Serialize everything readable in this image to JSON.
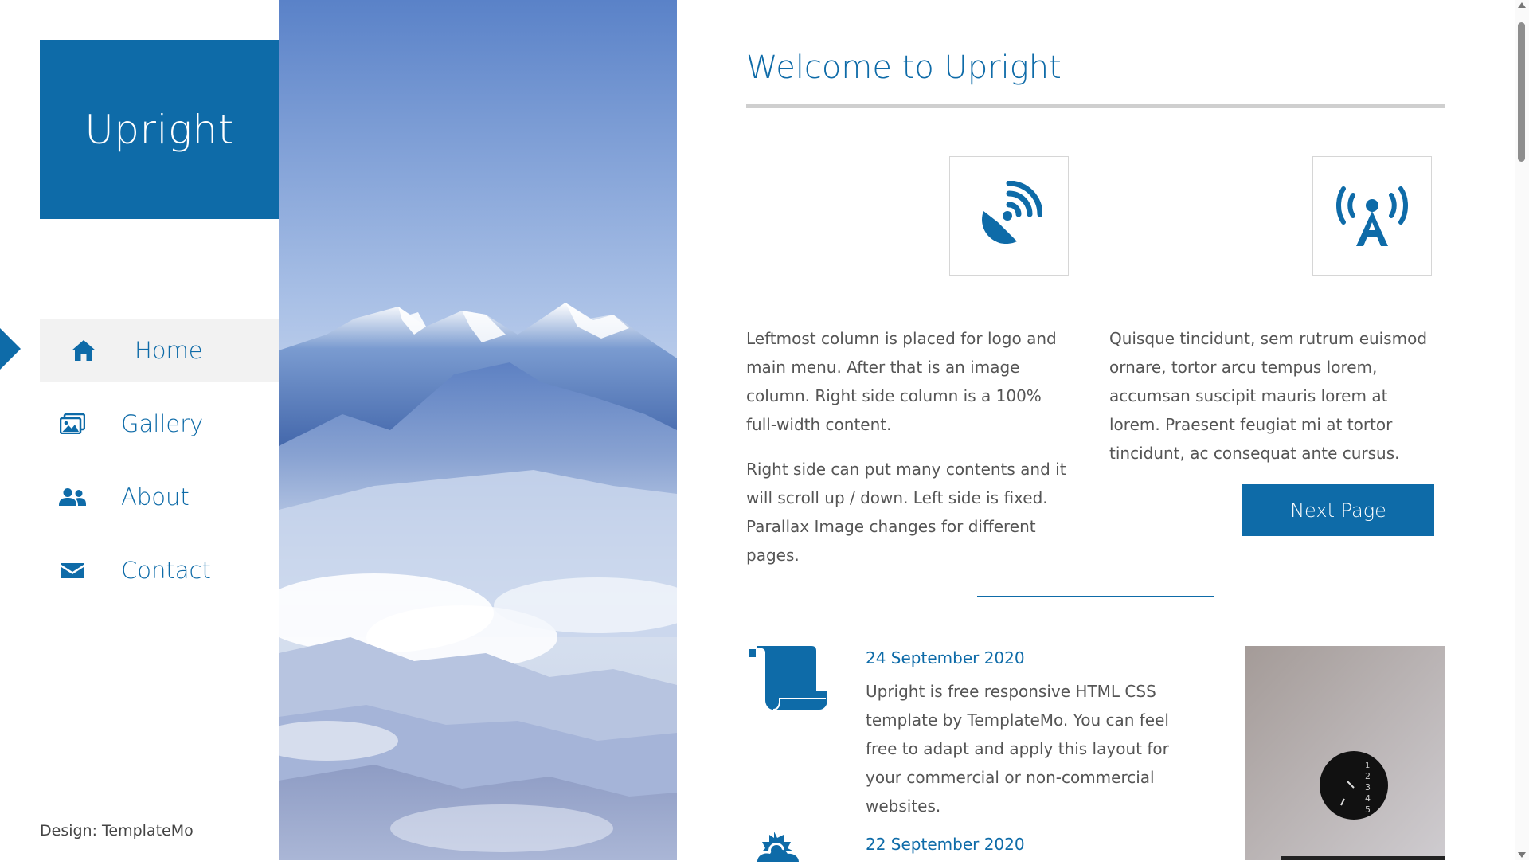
{
  "brand": {
    "name": "Upright",
    "color": "#0e6ba8"
  },
  "nav": {
    "items": [
      {
        "label": "Home",
        "icon": "home-icon",
        "active": true
      },
      {
        "label": "Gallery",
        "icon": "images-icon",
        "active": false
      },
      {
        "label": "About",
        "icon": "users-icon",
        "active": false
      },
      {
        "label": "Contact",
        "icon": "envelope-icon",
        "active": false
      }
    ]
  },
  "footer": {
    "credit": "Design: TemplateMo"
  },
  "main": {
    "title": "Welcome to Upright",
    "features": [
      {
        "icon": "satellite-dish-icon"
      },
      {
        "icon": "broadcast-tower-icon"
      }
    ],
    "left_paragraphs": [
      "Leftmost column is placed for logo and main menu. After that is an image column. Right side column is a 100% full-width content.",
      "Right side can put many contents and it will scroll up / down. Left side is fixed. Parallax Image changes for different pages."
    ],
    "right_paragraph": "Quisque tincidunt, sem rutrum euismod ornare, tortor arcu tempus lorem, accumsan suscipit mauris lorem at lorem. Praesent feugiat mi at tortor tincidunt, ac consequat ante cursus.",
    "next_button": "Next Page",
    "posts": [
      {
        "date": "24 September 2020",
        "icon": "scroll-icon",
        "text": "Upright is free responsive HTML CSS template by TemplateMo. You can feel free to adapt and apply this layout for your commercial or non-commercial websites."
      },
      {
        "date": "22 September 2020",
        "icon": "sun-cloud-icon",
        "text": ""
      }
    ]
  }
}
